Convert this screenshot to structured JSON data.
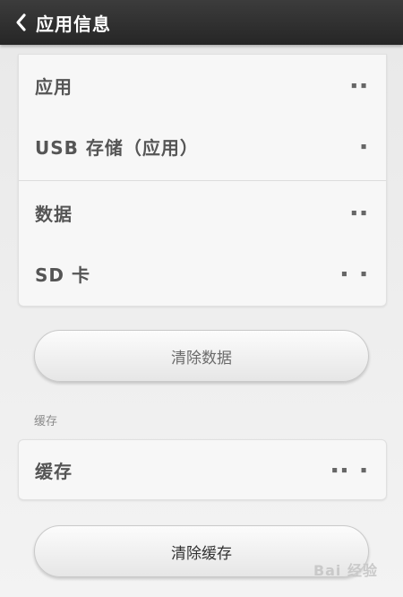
{
  "header": {
    "title": "应用信息"
  },
  "storage": {
    "rows": [
      {
        "label": "应用",
        "value": "▪▪"
      },
      {
        "label": "USB 存储（应用）",
        "value": "▪"
      },
      {
        "label": "数据",
        "value": "▪▪"
      },
      {
        "label": "SD 卡",
        "value": "▪ ▪"
      }
    ]
  },
  "buttons": {
    "clear_data": "清除数据",
    "clear_cache": "清除缓存"
  },
  "cache": {
    "section_label": "缓存",
    "row_label": "缓存",
    "row_value": "▪▪ ▪"
  },
  "watermark": "Bai 经验"
}
